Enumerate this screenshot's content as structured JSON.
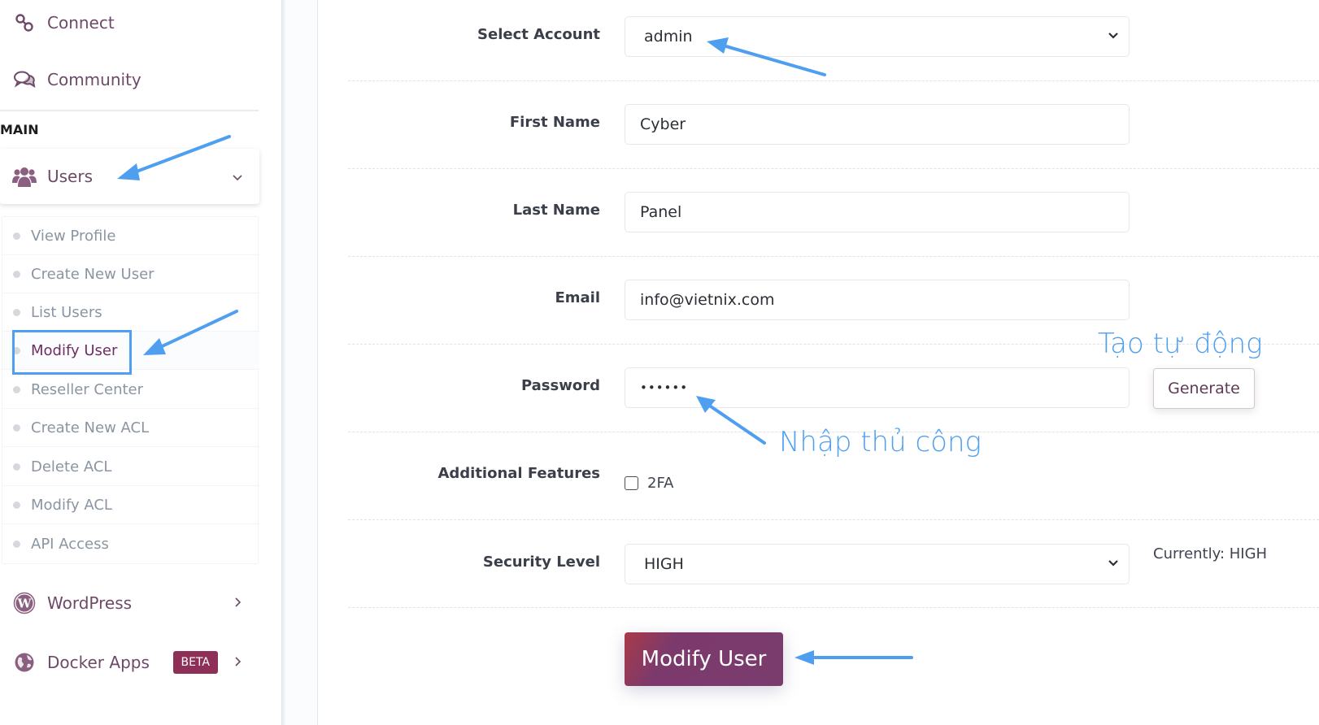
{
  "sidebar": {
    "top_items": [
      {
        "label": "Connect",
        "icon": "link-icon"
      },
      {
        "label": "Community",
        "icon": "chat-icon"
      }
    ],
    "section_label": "MAIN",
    "users": {
      "label": "Users",
      "icon": "users-icon",
      "expanded": true
    },
    "submenu": [
      {
        "label": "View Profile"
      },
      {
        "label": "Create New User"
      },
      {
        "label": "List Users"
      },
      {
        "label": "Modify User",
        "active": true
      },
      {
        "label": "Reseller Center"
      },
      {
        "label": "Create New ACL"
      },
      {
        "label": "Delete ACL"
      },
      {
        "label": "Modify ACL"
      },
      {
        "label": "API Access"
      }
    ],
    "bottom_items": [
      {
        "label": "WordPress",
        "icon": "wordpress-icon"
      },
      {
        "label": "Docker Apps",
        "icon": "globe-icon",
        "badge": "BETA"
      }
    ]
  },
  "form": {
    "select_account": {
      "label": "Select Account",
      "value": "admin"
    },
    "first_name": {
      "label": "First Name",
      "value": "Cyber"
    },
    "last_name": {
      "label": "Last Name",
      "value": "Panel"
    },
    "email": {
      "label": "Email",
      "value": "info@vietnix.com"
    },
    "password": {
      "label": "Password",
      "value": "••••••",
      "generate_label": "Generate"
    },
    "additional_features": {
      "label": "Additional Features",
      "option_label": "2FA",
      "checked": false
    },
    "security_level": {
      "label": "Security Level",
      "value": "HIGH",
      "currently": "Currently: HIGH"
    },
    "submit_label": "Modify User"
  },
  "annotations": {
    "auto_generate": "Tạo tự động",
    "manual_entry": "Nhập thủ công",
    "color": "#4f9ff0"
  },
  "colors": {
    "brand": "#7a3c6d",
    "sidebar_text": "#6e4a68",
    "badge": "#8d2f57"
  }
}
